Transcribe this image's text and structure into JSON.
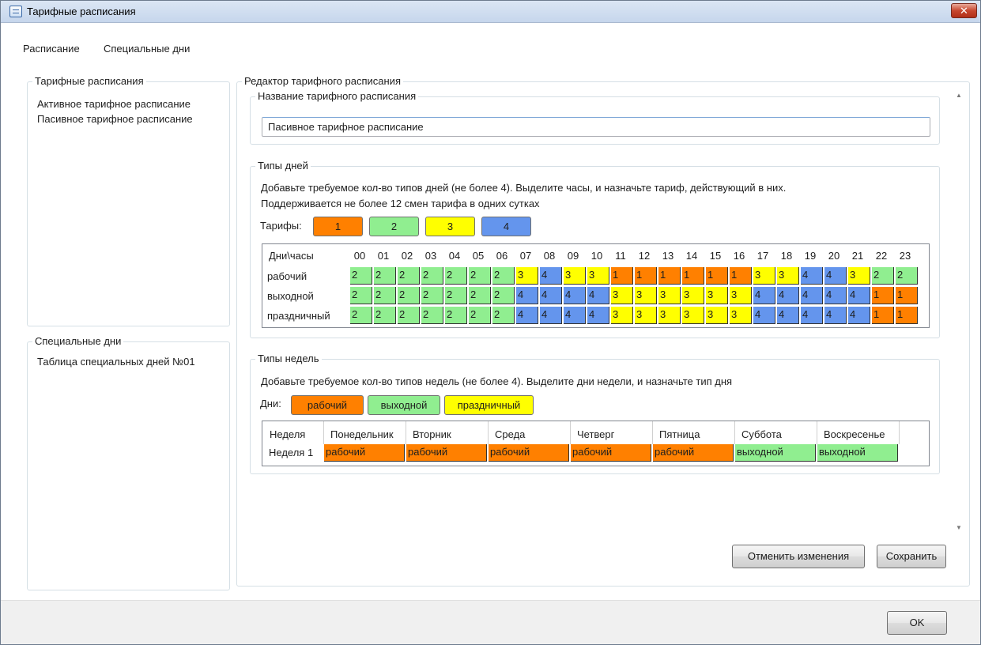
{
  "window": {
    "title": "Тарифные расписания",
    "close_label": "✕"
  },
  "menu": [
    "Расписание",
    "Специальные дни"
  ],
  "schedules": {
    "title": "Тарифные расписания",
    "items": [
      "Активное тарифное расписание",
      "Пасивное тарифное расписание"
    ]
  },
  "special_days": {
    "title": "Специальные дни",
    "items": [
      "Таблица специальных дней №01"
    ]
  },
  "editor": {
    "title": "Редактор тарифного расписания",
    "name_group": {
      "title": "Название тарифного расписания",
      "value": "Пасивное тарифное расписание"
    },
    "day_types": {
      "title": "Типы дней",
      "description_line1": "Добавьте требуемое кол-во типов дней (не более 4). Выделите часы, и назначьте тариф, действующий в них.",
      "description_line2": "Поддерживается не более 12 смен тарифа в одних сутках",
      "tariffs_label": "Тарифы:",
      "tariffs": [
        "1",
        "2",
        "3",
        "4"
      ],
      "header_label": "Дни\\часы",
      "hours": [
        "00",
        "01",
        "02",
        "03",
        "04",
        "05",
        "06",
        "07",
        "08",
        "09",
        "10",
        "11",
        "12",
        "13",
        "14",
        "15",
        "16",
        "17",
        "18",
        "19",
        "20",
        "21",
        "22",
        "23"
      ],
      "rows": [
        {
          "name": "рабочий",
          "values": [
            "2",
            "2",
            "2",
            "2",
            "2",
            "2",
            "2",
            "3",
            "4",
            "3",
            "3",
            "1",
            "1",
            "1",
            "1",
            "1",
            "1",
            "3",
            "3",
            "4",
            "4",
            "3",
            "2",
            "2"
          ]
        },
        {
          "name": "выходной",
          "values": [
            "2",
            "2",
            "2",
            "2",
            "2",
            "2",
            "2",
            "4",
            "4",
            "4",
            "4",
            "3",
            "3",
            "3",
            "3",
            "3",
            "3",
            "4",
            "4",
            "4",
            "4",
            "4",
            "1",
            "1"
          ]
        },
        {
          "name": "праздничный",
          "values": [
            "2",
            "2",
            "2",
            "2",
            "2",
            "2",
            "2",
            "4",
            "4",
            "4",
            "4",
            "3",
            "3",
            "3",
            "3",
            "3",
            "3",
            "4",
            "4",
            "4",
            "4",
            "4",
            "1",
            "1"
          ]
        }
      ]
    },
    "week_types": {
      "title": "Типы недель",
      "description": "Добавьте требуемое кол-во типов недель (не более 4). Выделите дни недели, и назначьте тип дня",
      "days_label": "Дни:",
      "day_type_buttons": [
        "рабочий",
        "выходной",
        "праздничный"
      ],
      "header_label": "Неделя",
      "weekdays": [
        "Понедельник",
        "Вторник",
        "Среда",
        "Четверг",
        "Пятница",
        "Суббота",
        "Воскресенье"
      ],
      "rows": [
        {
          "name": "Неделя 1",
          "values": [
            "рабочий",
            "рабочий",
            "рабочий",
            "рабочий",
            "рабочий",
            "выходной",
            "выходной"
          ]
        }
      ]
    },
    "cancel_label": "Отменить изменения",
    "save_label": "Сохранить"
  },
  "ok_label": "OK",
  "colors": {
    "tariff_1": "#ff8000",
    "tariff_2": "#90ee90",
    "tariff_3": "#ffff00",
    "tariff_4": "#6495ed",
    "day_type_рабочий": "#ff8000",
    "day_type_выходной": "#90ee90",
    "day_type_праздничный": "#ffff00"
  }
}
